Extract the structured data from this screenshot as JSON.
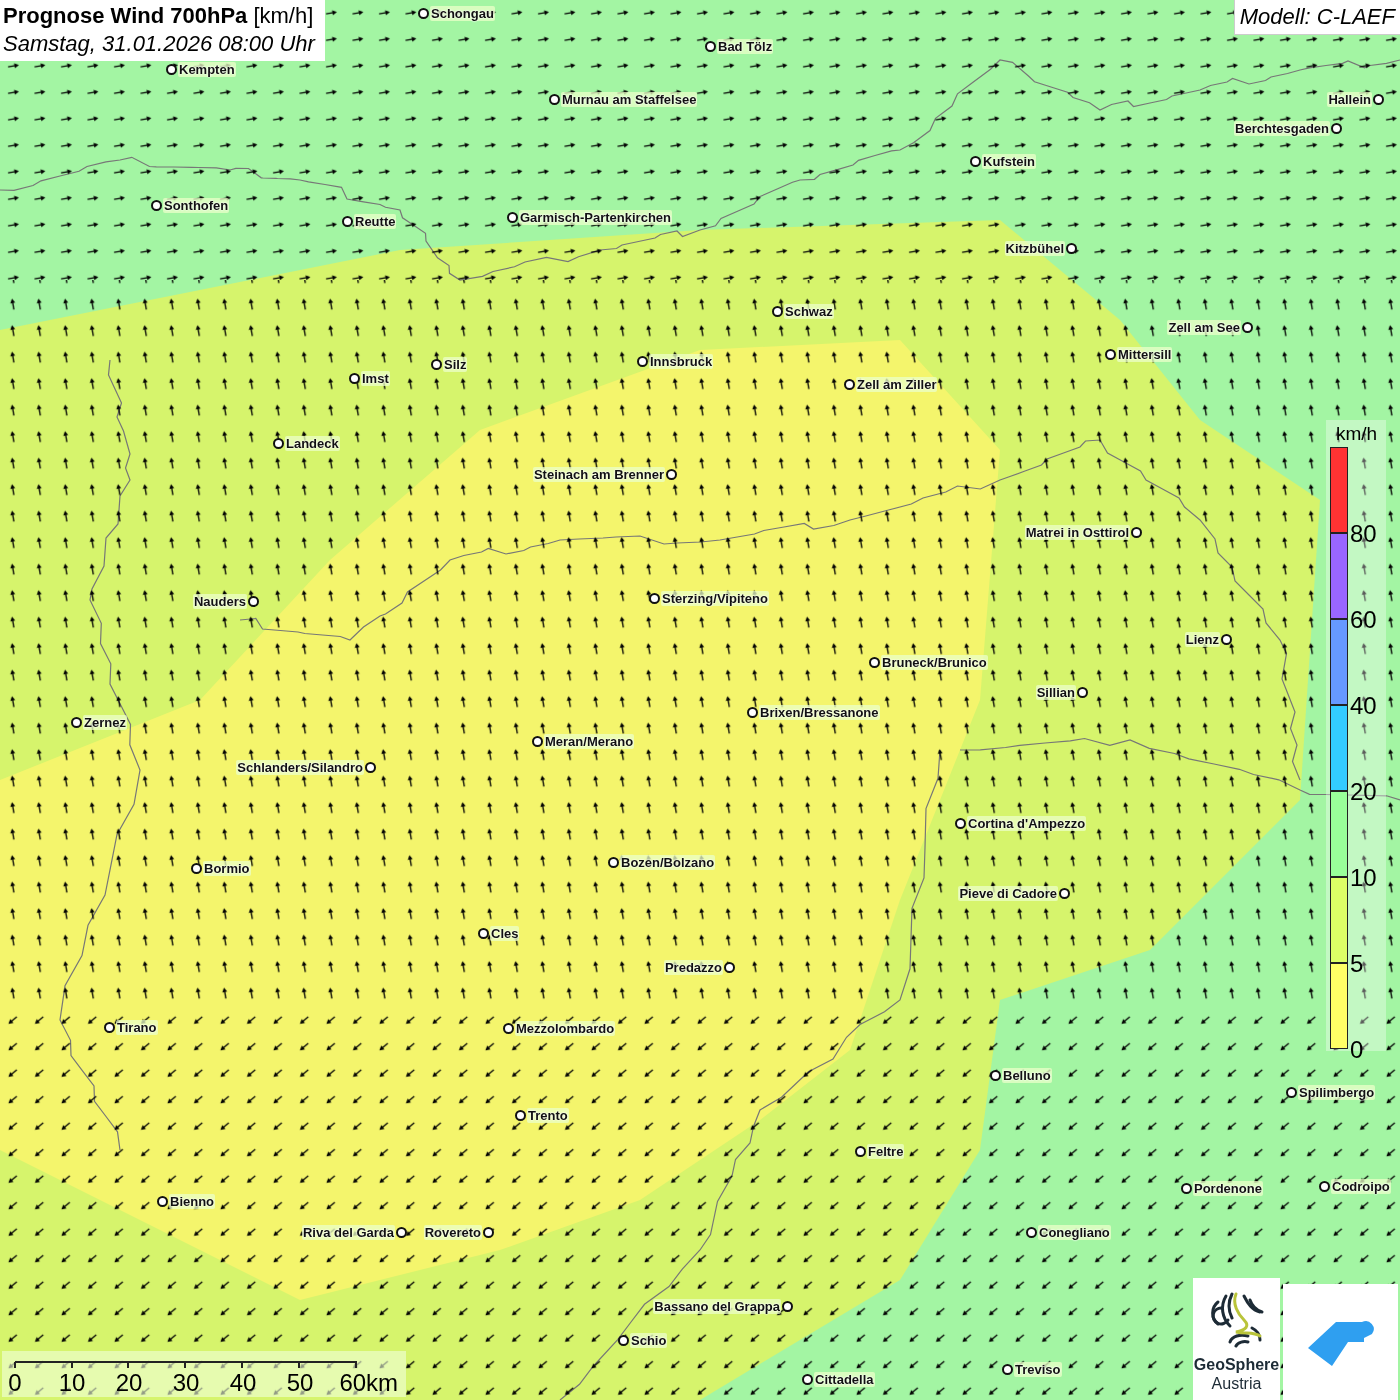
{
  "title": {
    "heading": "**Prognose Wind 700hPa** [km/h]",
    "subtitle": "Samstag, 31.01.2026 08:00 Uhr"
  },
  "model": "Modell: C-LAEF",
  "cities": [
    {
      "name": "Schongau"
    },
    {
      "name": "Bad Tölz"
    },
    {
      "name": "Kempten"
    },
    {
      "name": "Murnau am Staffelsee"
    },
    {
      "name": "Hallein"
    },
    {
      "name": "Berchtesgaden"
    },
    {
      "name": "Kufstein"
    },
    {
      "name": "Sonthofen"
    },
    {
      "name": "Reutte"
    },
    {
      "name": "Garmisch-Partenkirchen"
    },
    {
      "name": "Kitzbühel"
    },
    {
      "name": "Schwaz"
    },
    {
      "name": "Zell am See"
    },
    {
      "name": "Mittersill"
    },
    {
      "name": "Innsbruck"
    },
    {
      "name": "Silz"
    },
    {
      "name": "Zell am Ziller"
    },
    {
      "name": "Imst"
    },
    {
      "name": "Landeck"
    },
    {
      "name": "Steinach am Brenner"
    },
    {
      "name": "Matrei in Osttirol"
    },
    {
      "name": "Nauders"
    },
    {
      "name": "Sterzing/Vipiteno"
    },
    {
      "name": "Lienz"
    },
    {
      "name": "Bruneck/Brunico"
    },
    {
      "name": "Sillian"
    },
    {
      "name": "Brixen/Bressanone"
    },
    {
      "name": "Zernez"
    },
    {
      "name": "Meran/Merano"
    },
    {
      "name": "Schlanders/Silandro"
    },
    {
      "name": "Cortina d'Ampezzo"
    },
    {
      "name": "Bozen/Bolzano"
    },
    {
      "name": "Bormio"
    },
    {
      "name": "Pieve di Cadore"
    },
    {
      "name": "Cles"
    },
    {
      "name": "Predazzo"
    },
    {
      "name": "Tirano"
    },
    {
      "name": "Mezzolombardo"
    },
    {
      "name": "Belluno"
    },
    {
      "name": "Spilimbergo"
    },
    {
      "name": "Trento"
    },
    {
      "name": "Feltre"
    },
    {
      "name": "Pordenone"
    },
    {
      "name": "Codroipo"
    },
    {
      "name": "Bienno"
    },
    {
      "name": "Riva del Garda"
    },
    {
      "name": "Rovereto"
    },
    {
      "name": "Conegliano"
    },
    {
      "name": "Bassano del Grappa"
    },
    {
      "name": "Schio"
    },
    {
      "name": "Treviso"
    },
    {
      "name": "Cittadella"
    }
  ],
  "legend": {
    "unit": "km/h",
    "bands": [
      {
        "color": "#ff3333",
        "label": "80"
      },
      {
        "color": "#9966ff",
        "label": "60"
      },
      {
        "color": "#6699ff",
        "label": "40"
      },
      {
        "color": "#33ccff",
        "label": "20"
      },
      {
        "color": "#99ff99",
        "label": "10"
      },
      {
        "color": "#ddff66",
        "label": "5"
      },
      {
        "color": "#ffff66",
        "label": "0"
      }
    ]
  },
  "scale": {
    "ticks": [
      "0",
      "10",
      "20",
      "30",
      "40",
      "50",
      "60km"
    ]
  },
  "logos": {
    "name": "GeoSphere",
    "subname": "Austria"
  }
}
